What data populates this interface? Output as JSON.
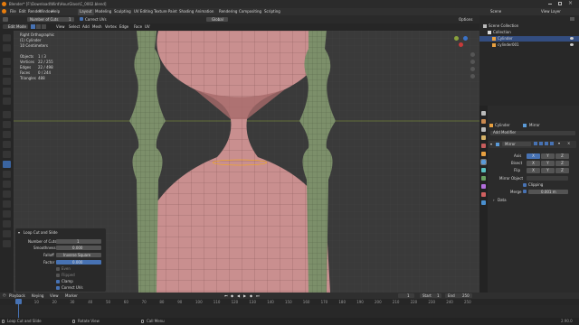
{
  "window": {
    "title": "Blender* [F:\\Download\\Wird\\HourGlass\\C_0002.blend]"
  },
  "menu": [
    "File",
    "Edit",
    "Render",
    "Window",
    "Help"
  ],
  "workspace_tabs": [
    "Layout",
    "Modeling",
    "Sculpting",
    "UV Editing",
    "Texture Paint",
    "Shading",
    "Animation",
    "Rendering",
    "Compositing",
    "Scripting"
  ],
  "active_tab": "Layout",
  "scene": {
    "label": "Scene",
    "view_layer": "View Layer"
  },
  "toolbar": {
    "loop_label": "Number of Cuts",
    "loop_value": "1",
    "correct_uvs": "Correct UVs",
    "transform": "Global",
    "options": "Options"
  },
  "header2": {
    "mode": "Edit Mode",
    "items": [
      "View",
      "Select",
      "Add",
      "Mesh",
      "Vertex",
      "Edge",
      "Face",
      "UV"
    ]
  },
  "viewport_info": {
    "view": "Right Orthographic",
    "object": "(1) Cylinder",
    "units": "10 Centimeters",
    "stats": [
      {
        "label": "Objects",
        "value": "1 / 3"
      },
      {
        "label": "Vertices",
        "value": "22 / 255"
      },
      {
        "label": "Edges",
        "value": "22 / 498"
      },
      {
        "label": "Faces",
        "value": "0 / 244"
      },
      {
        "label": "Triangles",
        "value": "488"
      }
    ]
  },
  "outliner": {
    "title": "Scene Collection",
    "items": [
      "Collection",
      "Cylinder",
      "cylinder001"
    ]
  },
  "properties": {
    "object": "Cylinder",
    "modifier_tab": "Mirror",
    "add_modifier": "Add Modifier",
    "modifier_name": "Mirror",
    "axis_label": "Axis",
    "bisect_label": "Bisect",
    "flip_label": "Flip",
    "axes": [
      "X",
      "Y",
      "Z"
    ],
    "mirror_object": "Mirror Object",
    "clipping": "Clipping",
    "merge_label": "Merge",
    "merge_value": "0.001 m",
    "data": "Data"
  },
  "operator": {
    "title": "Loop Cut and Slide",
    "number_of_cuts_label": "Number of Cuts",
    "number_of_cuts": "1",
    "smoothness_label": "Smoothness",
    "smoothness": "0.000",
    "falloff_label": "Falloff",
    "falloff": "Inverse Square",
    "factor_label": "Factor",
    "factor": "0.000",
    "even": "Even",
    "flipped": "Flipped",
    "clamp": "Clamp",
    "correct_uvs": "Correct UVs"
  },
  "timeline": {
    "menus": [
      "Playback",
      "Keying",
      "View",
      "Marker"
    ],
    "current_frame": "1",
    "start_label": "Start",
    "start": "1",
    "end_label": "End",
    "end": "250",
    "ruler": [
      "0",
      "10",
      "20",
      "30",
      "40",
      "50",
      "60",
      "70",
      "80",
      "90",
      "100",
      "110",
      "120",
      "130",
      "140",
      "150",
      "160",
      "170",
      "180",
      "190",
      "200",
      "210",
      "220",
      "230",
      "240",
      "250"
    ]
  },
  "status": {
    "items": [
      "Loop Cut and Slide",
      "Rotate View",
      "Call Menu"
    ],
    "version": "2.90.0"
  },
  "colors": {
    "accent": "#4772b3",
    "mesh_body": "#c98f8f",
    "mesh_pillar": "#7c8f6a",
    "viewport_bg": "#3a3a3a"
  }
}
